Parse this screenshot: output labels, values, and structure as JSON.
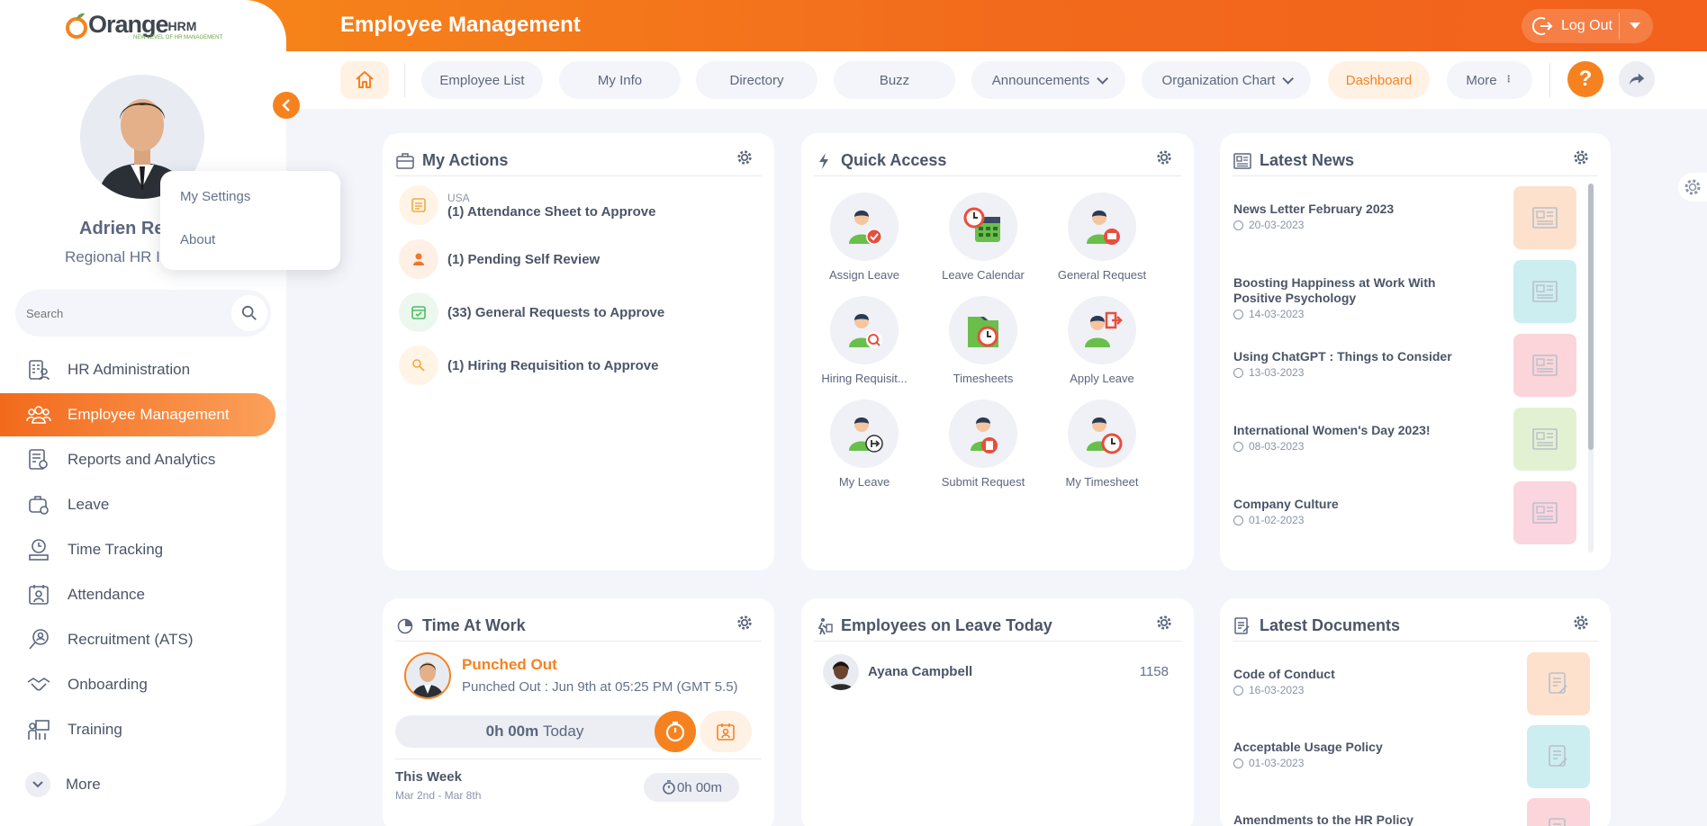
{
  "header": {
    "title": "Employee Management",
    "logout_label": "Log Out"
  },
  "logo": {
    "part1": "Orange",
    "part2": "HRM",
    "tagline": "NEW LEVEL OF HR MANAGEMENT"
  },
  "user": {
    "name": "Adrien Re",
    "role": "Regional HR I"
  },
  "popup": {
    "items": [
      "My Settings",
      "About"
    ]
  },
  "search": {
    "placeholder": "Search"
  },
  "nav": {
    "tabs": [
      {
        "label": "Employee List"
      },
      {
        "label": "My Info"
      },
      {
        "label": "Directory"
      },
      {
        "label": "Buzz"
      },
      {
        "label": "Announcements"
      },
      {
        "label": "Organization Chart"
      },
      {
        "label": "Dashboard"
      },
      {
        "label": "More"
      }
    ],
    "help_label": "?"
  },
  "sidebar": {
    "items": [
      {
        "label": "HR Administration",
        "icon": "hr-admin-icon"
      },
      {
        "label": "Employee Management",
        "icon": "employee-icon"
      },
      {
        "label": "Reports and Analytics",
        "icon": "reports-icon"
      },
      {
        "label": "Leave",
        "icon": "leave-icon"
      },
      {
        "label": "Time Tracking",
        "icon": "time-icon"
      },
      {
        "label": "Attendance",
        "icon": "attendance-icon"
      },
      {
        "label": "Recruitment (ATS)",
        "icon": "recruitment-icon"
      },
      {
        "label": "Onboarding",
        "icon": "onboarding-icon"
      },
      {
        "label": "Training",
        "icon": "training-icon"
      },
      {
        "label": "More",
        "icon": "chevron-down-icon"
      }
    ]
  },
  "my_actions": {
    "title": "My Actions",
    "items": [
      {
        "sub": "USA",
        "label": "(1) Attendance Sheet to Approve",
        "color": "#fff4e6"
      },
      {
        "sub": "",
        "label": "(1) Pending Self Review",
        "color": "#fff0e5"
      },
      {
        "sub": "",
        "label": "(33) General Requests to Approve",
        "color": "#ecf8ee"
      },
      {
        "sub": "",
        "label": "(1) Hiring Requisition to Approve",
        "color": "#fff4e6"
      }
    ]
  },
  "quick_access": {
    "title": "Quick Access",
    "items": [
      "Assign Leave",
      "Leave Calendar",
      "General Request",
      "Hiring Requisit...",
      "Timesheets",
      "Apply Leave",
      "My Leave",
      "Submit Request",
      "My Timesheet"
    ]
  },
  "latest_news": {
    "title": "Latest News",
    "items": [
      {
        "title": "News Letter February 2023",
        "date": "20-03-2023",
        "color": "#fde1cd"
      },
      {
        "title": "Boosting Happiness at Work With Positive Psychology",
        "date": "14-03-2023",
        "color": "#cdeef0"
      },
      {
        "title": "Using ChatGPT : Things to Consider",
        "date": "13-03-2023",
        "color": "#fbd5da"
      },
      {
        "title": "International Women's Day 2023!",
        "date": "08-03-2023",
        "color": "#e3f1d3"
      },
      {
        "title": "Company Culture",
        "date": "01-02-2023",
        "color": "#fbd5df"
      }
    ]
  },
  "time_at_work": {
    "title": "Time At Work",
    "status": "Punched Out",
    "detail": "Punched Out : Jun 9th at 05:25 PM (GMT 5.5)",
    "today_value": "0h 00m",
    "today_label": "Today",
    "week_label": "This Week",
    "week_range": "Mar 2nd - Mar 8th",
    "week_value": "0h 00m"
  },
  "on_leave": {
    "title": "Employees on Leave Today",
    "items": [
      {
        "name": "Ayana Campbell",
        "id": "1158"
      }
    ]
  },
  "latest_documents": {
    "title": "Latest Documents",
    "items": [
      {
        "title": "Code of Conduct",
        "date": "16-03-2023",
        "color": "#fde1cd"
      },
      {
        "title": "Acceptable Usage Policy",
        "date": "01-03-2023",
        "color": "#cdeef0"
      },
      {
        "title": "Amendments to the HR Policy",
        "date": "",
        "color": "#fbd5da"
      }
    ]
  },
  "colors": {
    "accent": "#f6821f",
    "header_start": "#f78c1a",
    "header_end": "#f3611d"
  }
}
